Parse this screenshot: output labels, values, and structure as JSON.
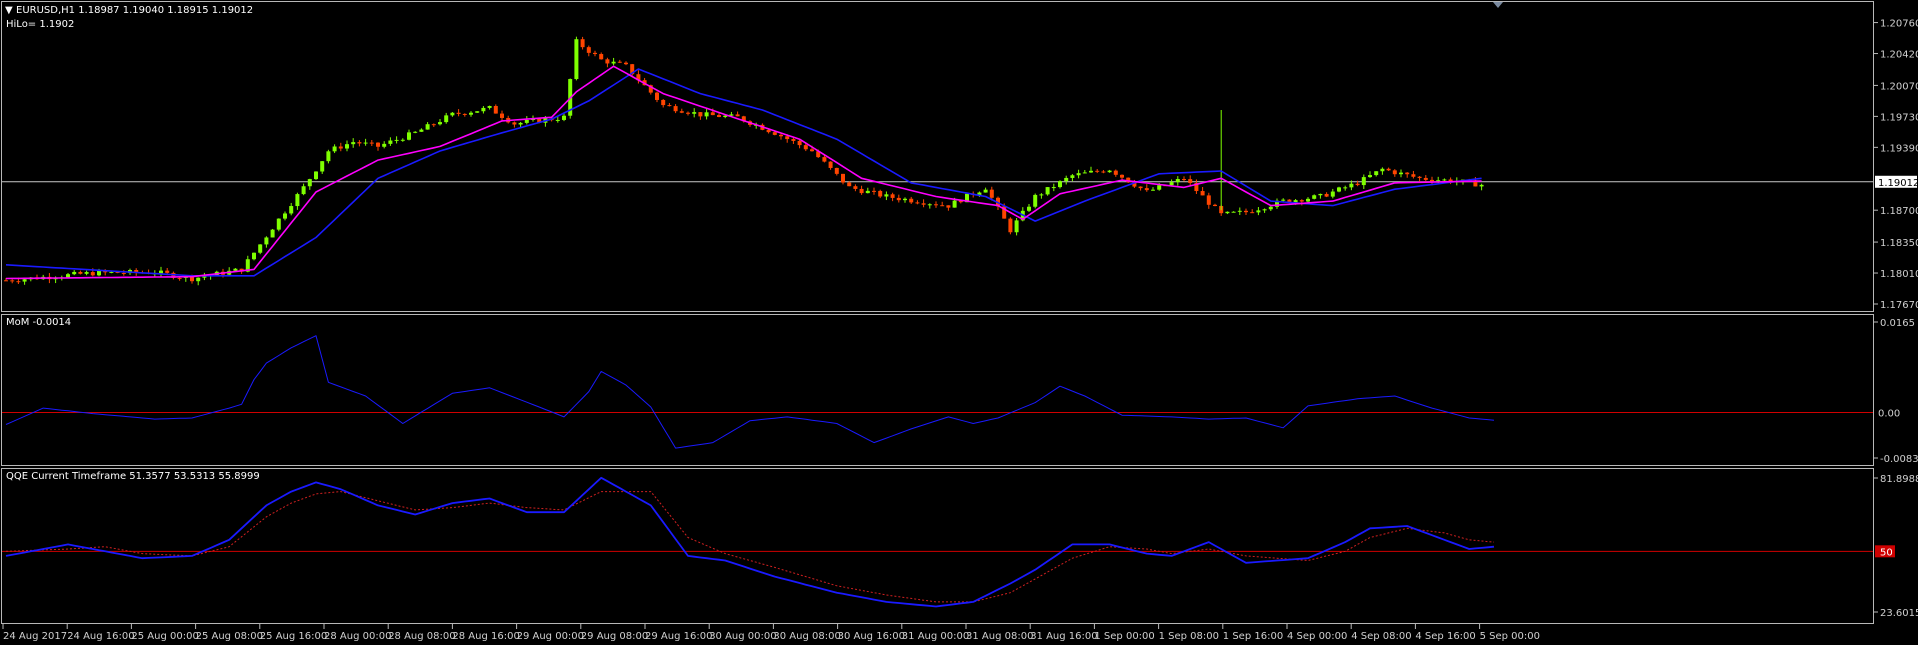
{
  "colors": {
    "background": "#000000",
    "frame": "#b8b8b8",
    "bull": "#7fff00",
    "bear": "#ff4500",
    "ma_fast": "#ff00ff",
    "ma_slow": "#1a1aff",
    "zero_line": "#d00000",
    "price_line": "#c8c8c8",
    "mom_line": "#1a1aff",
    "qqe_line": "#1a1aff",
    "qqe_signal": "#d02020",
    "price_tag_bg": "#ffffff",
    "price_tag_text": "#000000",
    "red_tag_bg": "#d00000"
  },
  "price_panel": {
    "header": "EURUSD,H1  1.18987 1.19040 1.18915 1.19012",
    "hilo": "HiLo= 1.1902",
    "current_price_label": "1.19012",
    "marker_icon": "triangle-down-icon"
  },
  "mom_panel": {
    "header": "MoM  -0.0014",
    "zero_label": "0.00"
  },
  "qqe_panel": {
    "header": "QQE Current Timeframe 51.3577 53.5313 55.8999",
    "level_label": "50"
  },
  "chart_data": [
    {
      "type": "candlestick",
      "name_label": "EURUSD,H1",
      "y_ticks": [
        "1.20760",
        "1.20420",
        "1.20070",
        "1.19730",
        "1.19390",
        "1.18700",
        "1.18350",
        "1.18010",
        "1.17670"
      ],
      "ylim": [
        1.1767,
        1.2092
      ],
      "current_price": 1.19012,
      "anchors": [
        [
          0,
          1.1793
        ],
        [
          14,
          1.1801
        ],
        [
          24,
          1.1802
        ],
        [
          30,
          1.1795
        ],
        [
          38,
          1.1805
        ],
        [
          44,
          1.186
        ],
        [
          48,
          1.1895
        ],
        [
          52,
          1.1935
        ],
        [
          56,
          1.1945
        ],
        [
          60,
          1.194
        ],
        [
          66,
          1.1955
        ],
        [
          72,
          1.1975
        ],
        [
          78,
          1.1982
        ],
        [
          82,
          1.1965
        ],
        [
          90,
          1.1972
        ],
        [
          92,
          1.2055
        ],
        [
          96,
          1.2035
        ],
        [
          100,
          1.2028
        ],
        [
          106,
          1.1985
        ],
        [
          112,
          1.1975
        ],
        [
          118,
          1.1972
        ],
        [
          124,
          1.1955
        ],
        [
          130,
          1.1935
        ],
        [
          136,
          1.1895
        ],
        [
          142,
          1.1885
        ],
        [
          152,
          1.1875
        ],
        [
          158,
          1.1895
        ],
        [
          162,
          1.1848
        ],
        [
          166,
          1.1885
        ],
        [
          172,
          1.1908
        ],
        [
          178,
          1.1915
        ],
        [
          184,
          1.189
        ],
        [
          190,
          1.1905
        ],
        [
          196,
          1.1865
        ],
        [
          200,
          1.1868
        ],
        [
          206,
          1.188
        ],
        [
          212,
          1.1885
        ],
        [
          218,
          1.19
        ],
        [
          222,
          1.1915
        ],
        [
          228,
          1.1905
        ],
        [
          234,
          1.1902
        ],
        [
          238,
          1.1898
        ]
      ],
      "indicators": {
        "ma_fast_anchors": [
          [
            0,
            1.1795
          ],
          [
            30,
            1.1797
          ],
          [
            40,
            1.1805
          ],
          [
            50,
            1.189
          ],
          [
            60,
            1.1925
          ],
          [
            70,
            1.194
          ],
          [
            80,
            1.1968
          ],
          [
            88,
            1.1972
          ],
          [
            92,
            1.2
          ],
          [
            98,
            1.2028
          ],
          [
            106,
            1.1998
          ],
          [
            116,
            1.1975
          ],
          [
            128,
            1.1948
          ],
          [
            138,
            1.1905
          ],
          [
            150,
            1.1885
          ],
          [
            160,
            1.1875
          ],
          [
            164,
            1.186
          ],
          [
            170,
            1.1888
          ],
          [
            180,
            1.1903
          ],
          [
            190,
            1.1895
          ],
          [
            196,
            1.1905
          ],
          [
            204,
            1.1875
          ],
          [
            214,
            1.188
          ],
          [
            224,
            1.19
          ],
          [
            238,
            1.1902
          ]
        ],
        "ma_slow_anchors": [
          [
            0,
            1.181
          ],
          [
            30,
            1.1798
          ],
          [
            40,
            1.1798
          ],
          [
            50,
            1.184
          ],
          [
            60,
            1.1905
          ],
          [
            70,
            1.1935
          ],
          [
            80,
            1.1955
          ],
          [
            88,
            1.197
          ],
          [
            94,
            1.199
          ],
          [
            102,
            1.2025
          ],
          [
            112,
            1.1998
          ],
          [
            122,
            1.198
          ],
          [
            134,
            1.1948
          ],
          [
            146,
            1.19
          ],
          [
            158,
            1.1885
          ],
          [
            166,
            1.1858
          ],
          [
            174,
            1.188
          ],
          [
            186,
            1.191
          ],
          [
            196,
            1.1913
          ],
          [
            204,
            1.188
          ],
          [
            214,
            1.1875
          ],
          [
            224,
            1.1893
          ],
          [
            238,
            1.1905
          ]
        ]
      }
    },
    {
      "type": "line",
      "name_label": "MoM",
      "y_ticks": [
        "0.0165",
        "0.00",
        "-0.0083"
      ],
      "ylim": [
        -0.0083,
        0.0165
      ],
      "reference_level": 0.0,
      "anchors": [
        [
          0,
          -0.0022
        ],
        [
          6,
          0.0008
        ],
        [
          14,
          -0.0002
        ],
        [
          24,
          -0.0012
        ],
        [
          30,
          -0.001
        ],
        [
          36,
          0.0008
        ],
        [
          38,
          0.0015
        ],
        [
          40,
          0.006
        ],
        [
          42,
          0.009
        ],
        [
          46,
          0.0118
        ],
        [
          50,
          0.014
        ],
        [
          52,
          0.0055
        ],
        [
          58,
          0.003
        ],
        [
          64,
          -0.002
        ],
        [
          72,
          0.0035
        ],
        [
          78,
          0.0045
        ],
        [
          86,
          0.001
        ],
        [
          90,
          -0.0008
        ],
        [
          94,
          0.0038
        ],
        [
          96,
          0.0075
        ],
        [
          100,
          0.005
        ],
        [
          104,
          0.001
        ],
        [
          108,
          -0.0065
        ],
        [
          114,
          -0.0055
        ],
        [
          120,
          -0.0015
        ],
        [
          126,
          -0.0008
        ],
        [
          134,
          -0.002
        ],
        [
          140,
          -0.0055
        ],
        [
          146,
          -0.003
        ],
        [
          152,
          -0.0008
        ],
        [
          156,
          -0.002
        ],
        [
          160,
          -0.001
        ],
        [
          166,
          0.0018
        ],
        [
          170,
          0.0048
        ],
        [
          174,
          0.003
        ],
        [
          180,
          -0.0005
        ],
        [
          188,
          -0.0008
        ],
        [
          194,
          -0.0012
        ],
        [
          200,
          -0.001
        ],
        [
          206,
          -0.0028
        ],
        [
          210,
          0.0012
        ],
        [
          218,
          0.0025
        ],
        [
          224,
          0.003
        ],
        [
          230,
          0.0008
        ],
        [
          236,
          -0.001
        ],
        [
          240,
          -0.0014
        ]
      ]
    },
    {
      "type": "line",
      "name_label": "QQE Current Timeframe",
      "y_ticks": [
        "81.8988",
        "50",
        "23.6015"
      ],
      "ylim": [
        23.6015,
        81.8988
      ],
      "reference_level": 50,
      "series_values_label": [
        "51.3577",
        "53.5313",
        "55.8999"
      ],
      "anchors": [
        [
          0,
          48
        ],
        [
          10,
          53
        ],
        [
          16,
          50
        ],
        [
          22,
          47
        ],
        [
          30,
          48
        ],
        [
          36,
          55
        ],
        [
          42,
          70
        ],
        [
          46,
          76
        ],
        [
          50,
          80
        ],
        [
          54,
          77
        ],
        [
          60,
          70
        ],
        [
          66,
          66
        ],
        [
          72,
          71
        ],
        [
          78,
          73
        ],
        [
          84,
          67
        ],
        [
          90,
          67
        ],
        [
          96,
          82
        ],
        [
          104,
          70
        ],
        [
          110,
          48
        ],
        [
          116,
          46
        ],
        [
          124,
          39
        ],
        [
          134,
          32
        ],
        [
          142,
          28
        ],
        [
          150,
          26
        ],
        [
          156,
          28
        ],
        [
          162,
          36
        ],
        [
          166,
          42
        ],
        [
          172,
          53
        ],
        [
          178,
          53
        ],
        [
          184,
          49
        ],
        [
          188,
          48
        ],
        [
          194,
          54
        ],
        [
          200,
          45
        ],
        [
          210,
          47
        ],
        [
          216,
          54
        ],
        [
          220,
          60
        ],
        [
          226,
          61
        ],
        [
          232,
          55
        ],
        [
          236,
          51
        ],
        [
          240,
          52
        ]
      ],
      "signal_anchors": [
        [
          0,
          50
        ],
        [
          10,
          51
        ],
        [
          16,
          52
        ],
        [
          22,
          49
        ],
        [
          30,
          48
        ],
        [
          36,
          52
        ],
        [
          42,
          65
        ],
        [
          46,
          71
        ],
        [
          50,
          75
        ],
        [
          54,
          76
        ],
        [
          60,
          72
        ],
        [
          66,
          68
        ],
        [
          72,
          69
        ],
        [
          78,
          71
        ],
        [
          84,
          69
        ],
        [
          90,
          68
        ],
        [
          96,
          76
        ],
        [
          104,
          76
        ],
        [
          110,
          56
        ],
        [
          116,
          49
        ],
        [
          124,
          43
        ],
        [
          134,
          35
        ],
        [
          142,
          31
        ],
        [
          150,
          28
        ],
        [
          156,
          28
        ],
        [
          162,
          32
        ],
        [
          166,
          38
        ],
        [
          172,
          47
        ],
        [
          178,
          52
        ],
        [
          184,
          51
        ],
        [
          188,
          49
        ],
        [
          194,
          51
        ],
        [
          200,
          48
        ],
        [
          210,
          46
        ],
        [
          216,
          50
        ],
        [
          220,
          56
        ],
        [
          226,
          60
        ],
        [
          232,
          58
        ],
        [
          236,
          55
        ],
        [
          240,
          54
        ]
      ]
    }
  ],
  "x_axis": {
    "labels": [
      "24 Aug 2017",
      "24 Aug 16:00",
      "25 Aug 00:00",
      "25 Aug 08:00",
      "25 Aug 16:00",
      "28 Aug 00:00",
      "28 Aug 08:00",
      "28 Aug 16:00",
      "29 Aug 00:00",
      "29 Aug 08:00",
      "29 Aug 16:00",
      "30 Aug 00:00",
      "30 Aug 08:00",
      "30 Aug 16:00",
      "31 Aug 00:00",
      "31 Aug 08:00",
      "31 Aug 16:00",
      "1 Sep 00:00",
      "1 Sep 08:00",
      "1 Sep 16:00",
      "4 Sep 00:00",
      "4 Sep 08:00",
      "4 Sep 16:00",
      "5 Sep 00:00"
    ]
  }
}
